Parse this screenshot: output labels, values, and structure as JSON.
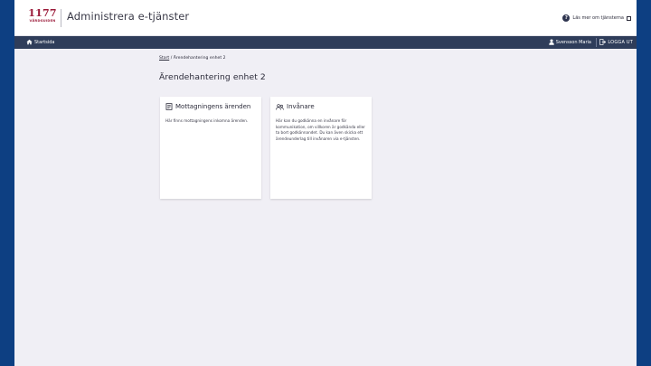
{
  "header": {
    "logo_number": "1177",
    "logo_subtitle": "VÅRDGUIDEN",
    "app_title": "Administrera e-tjänster",
    "help_link": "Läs mer om tjänsterna"
  },
  "navbar": {
    "home_label": "Startsida",
    "user_label": "Svensson Maria",
    "logout_label": "LOGGA UT"
  },
  "breadcrumb": {
    "start_label": "Start",
    "separator": "/",
    "current": "Ärendehantering enhet 2"
  },
  "page": {
    "title": "Ärendehantering enhet 2"
  },
  "cards": [
    {
      "title": "Mottagningens ärenden",
      "icon": "document-icon",
      "text": "Här finns mottagningens inkomna ärenden."
    },
    {
      "title": "Invånare",
      "icon": "people-icon",
      "text": "Här kan du godkänna en invånare för kommunikation, om villkoren är godkända eller ta bort godkännandet. Du kan även skicka ett ärendeunderlag till invånaren via e-tjänsten."
    }
  ],
  "colors": {
    "brand": "#9b1b3a",
    "navbar": "#2f3d5a",
    "page_background": "#f0eff5",
    "outer_background": "#0d3f82"
  }
}
